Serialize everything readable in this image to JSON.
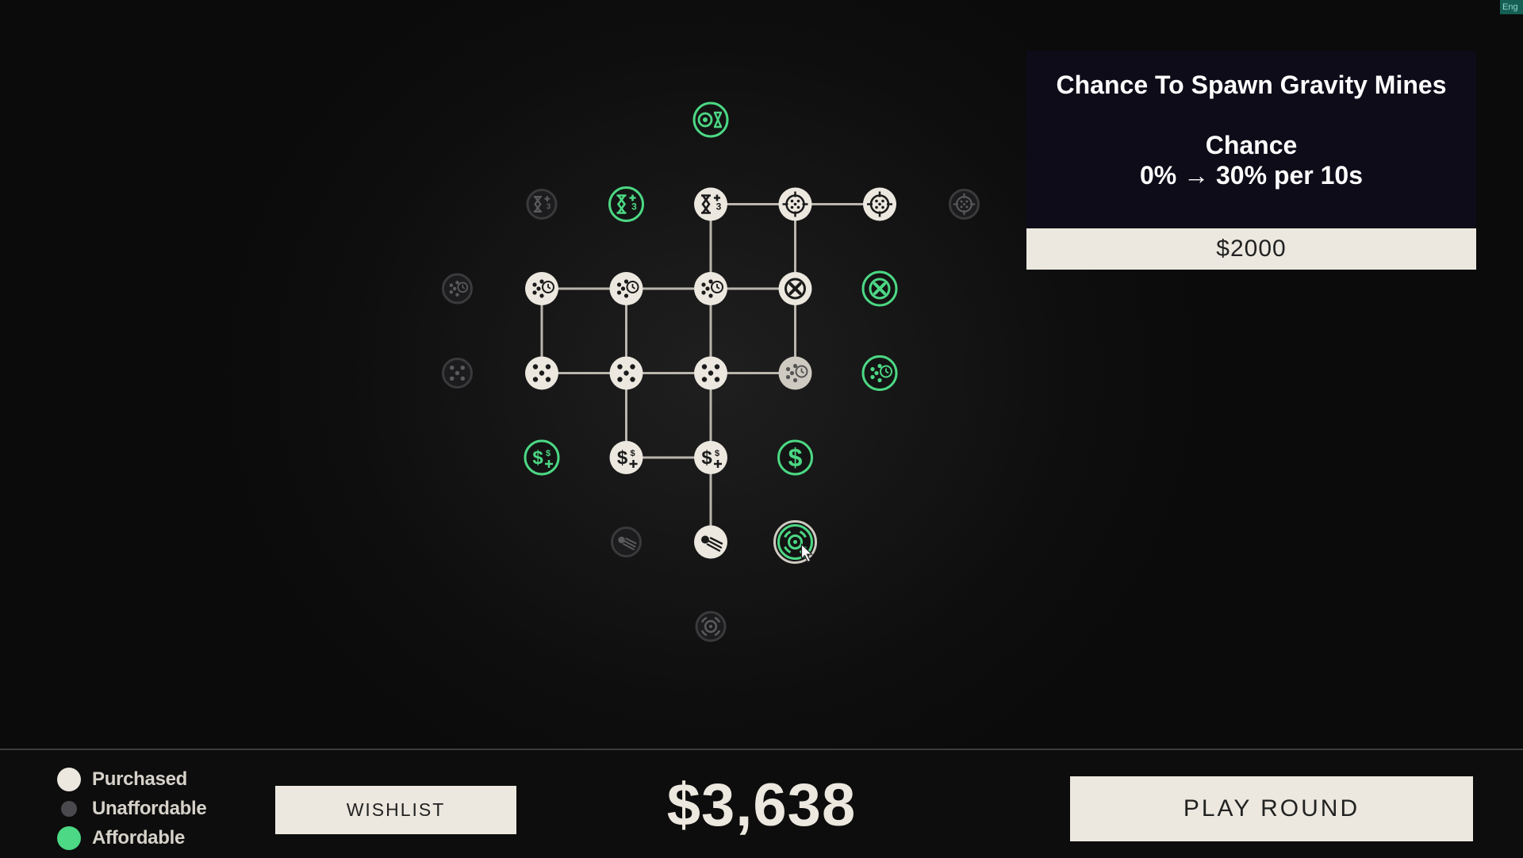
{
  "colors": {
    "purchased": "#ece8df",
    "affordable": "#4cd884",
    "unaffordable": "#2e2e30",
    "tooltip_bg": "#0d0c18"
  },
  "tooltip": {
    "title": "Chance To Spawn Gravity Mines",
    "stat_name": "Chance",
    "stat_value": "0% → 30% per 10s",
    "price": "$2000"
  },
  "legend": [
    {
      "label": "Purchased",
      "state": "purchased"
    },
    {
      "label": "Unaffordable",
      "state": "unaffordable"
    },
    {
      "label": "Affordable",
      "state": "affordable"
    }
  ],
  "buttons": {
    "wishlist": "WISHLIST",
    "play_round": "PLAY ROUND"
  },
  "money": "$3,638",
  "language_badge": "Eng",
  "skill_tree": {
    "nodes": [
      {
        "id": "n00",
        "col": 2,
        "row": 0,
        "state": "affordable",
        "icon": "mine-timer-icon"
      },
      {
        "id": "n10",
        "col": 0,
        "row": 1,
        "state": "unaffordable",
        "icon": "hourglass-plus-icon"
      },
      {
        "id": "n11",
        "col": 1,
        "row": 1,
        "state": "affordable",
        "icon": "hourglass-plus-icon"
      },
      {
        "id": "n12",
        "col": 2,
        "row": 1,
        "state": "purchased",
        "icon": "hourglass-plus-icon"
      },
      {
        "id": "n13",
        "col": 3,
        "row": 1,
        "state": "purchased",
        "icon": "crosshair-mine-icon"
      },
      {
        "id": "n14",
        "col": 4,
        "row": 1,
        "state": "purchased",
        "icon": "crosshair-mine-icon"
      },
      {
        "id": "n15",
        "col": 5,
        "row": 1,
        "state": "unaffordable",
        "icon": "crosshair-mine-icon"
      },
      {
        "id": "n20",
        "col": -1,
        "row": 2,
        "state": "unaffordable",
        "icon": "dice-clock-icon"
      },
      {
        "id": "n21",
        "col": 0,
        "row": 2,
        "state": "purchased",
        "icon": "dice-clock-icon"
      },
      {
        "id": "n22",
        "col": 1,
        "row": 2,
        "state": "purchased",
        "icon": "dice-clock-icon"
      },
      {
        "id": "n23",
        "col": 2,
        "row": 2,
        "state": "purchased",
        "icon": "dice-clock-icon"
      },
      {
        "id": "n24",
        "col": 3,
        "row": 2,
        "state": "purchased",
        "icon": "x-circle-icon"
      },
      {
        "id": "n25",
        "col": 4,
        "row": 2,
        "state": "affordable",
        "icon": "x-circle-icon"
      },
      {
        "id": "n30",
        "col": -1,
        "row": 3,
        "state": "unaffordable",
        "icon": "dice-icon"
      },
      {
        "id": "n31",
        "col": 0,
        "row": 3,
        "state": "purchased",
        "icon": "dice-icon"
      },
      {
        "id": "n32",
        "col": 1,
        "row": 3,
        "state": "purchased",
        "icon": "dice-icon"
      },
      {
        "id": "n33",
        "col": 2,
        "row": 3,
        "state": "purchased",
        "icon": "dice-icon"
      },
      {
        "id": "n34",
        "col": 3,
        "row": 3,
        "state": "purchased-dim",
        "icon": "dice-clock-icon"
      },
      {
        "id": "n35",
        "col": 4,
        "row": 3,
        "state": "affordable",
        "icon": "dice-clock-icon"
      },
      {
        "id": "n41",
        "col": 0,
        "row": 4,
        "state": "affordable",
        "icon": "money-plus-icon"
      },
      {
        "id": "n42",
        "col": 1,
        "row": 4,
        "state": "purchased",
        "icon": "money-plus-icon"
      },
      {
        "id": "n43",
        "col": 2,
        "row": 4,
        "state": "purchased",
        "icon": "money-plus-icon"
      },
      {
        "id": "n44",
        "col": 3,
        "row": 4,
        "state": "affordable",
        "icon": "dollar-icon"
      },
      {
        "id": "n51",
        "col": 1,
        "row": 5,
        "state": "unaffordable",
        "icon": "comet-icon"
      },
      {
        "id": "n52",
        "col": 2,
        "row": 5,
        "state": "purchased",
        "icon": "comet-icon"
      },
      {
        "id": "n53",
        "col": 3,
        "row": 5,
        "state": "affordable-selected",
        "icon": "gravity-mine-icon"
      },
      {
        "id": "n62",
        "col": 2,
        "row": 6,
        "state": "unaffordable",
        "icon": "gravity-mine-icon"
      }
    ],
    "edges": [
      [
        "n12",
        "n13"
      ],
      [
        "n13",
        "n14"
      ],
      [
        "n12",
        "n23"
      ],
      [
        "n13",
        "n24"
      ],
      [
        "n21",
        "n22"
      ],
      [
        "n22",
        "n23"
      ],
      [
        "n23",
        "n24"
      ],
      [
        "n21",
        "n31"
      ],
      [
        "n22",
        "n32"
      ],
      [
        "n23",
        "n33"
      ],
      [
        "n24",
        "n34"
      ],
      [
        "n31",
        "n32"
      ],
      [
        "n32",
        "n33"
      ],
      [
        "n33",
        "n34"
      ],
      [
        "n32",
        "n42"
      ],
      [
        "n33",
        "n43"
      ],
      [
        "n42",
        "n43"
      ],
      [
        "n43",
        "n52"
      ]
    ]
  }
}
